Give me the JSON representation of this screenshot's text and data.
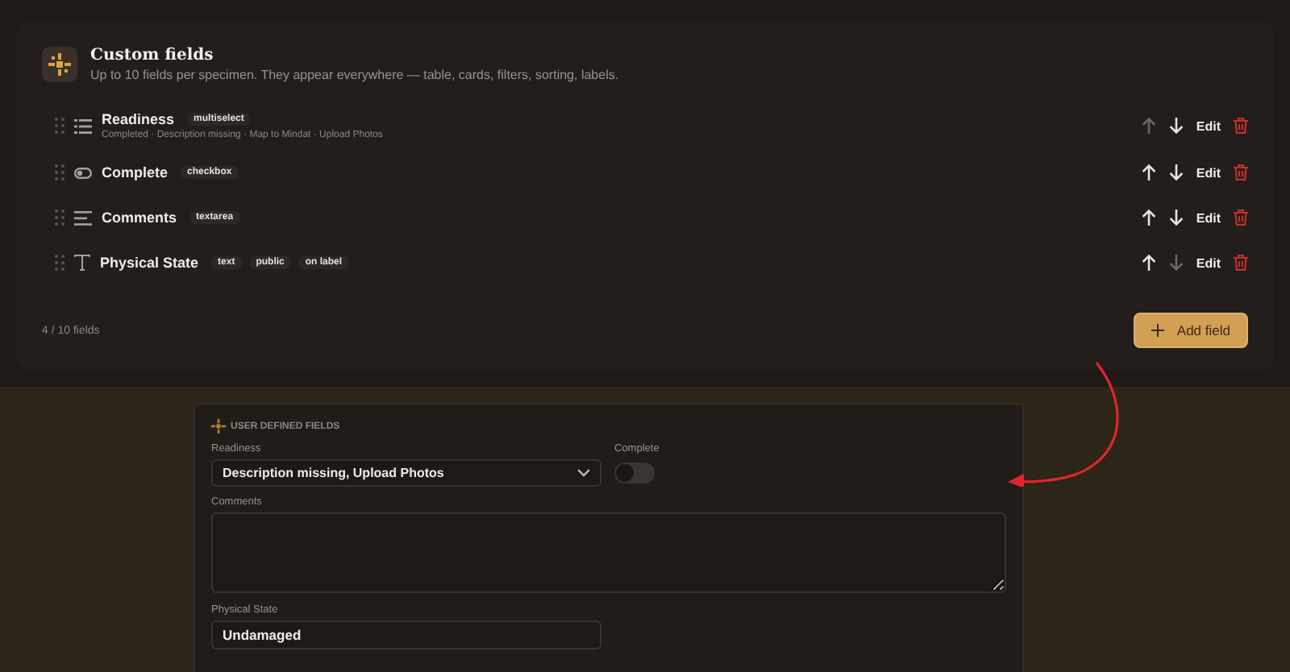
{
  "card": {
    "title": "Custom fields",
    "subtitle": "Up to 10 fields per specimen. They appear everywhere — table, cards, filters, sorting, labels.",
    "fields": [
      {
        "kind": "multiselect",
        "name": "Readiness",
        "tags": [
          "multiselect"
        ],
        "options": "Completed · Description missing · Map to Mindat · Upload Photos",
        "up_disabled": true,
        "down_disabled": false,
        "edit": "Edit"
      },
      {
        "kind": "checkbox",
        "name": "Complete",
        "tags": [
          "checkbox"
        ],
        "up_disabled": false,
        "down_disabled": false,
        "edit": "Edit"
      },
      {
        "kind": "textarea",
        "name": "Comments",
        "tags": [
          "textarea"
        ],
        "up_disabled": false,
        "down_disabled": false,
        "edit": "Edit"
      },
      {
        "kind": "text",
        "name": "Physical State",
        "tags": [
          "text",
          "public",
          "on label"
        ],
        "up_disabled": false,
        "down_disabled": true,
        "edit": "Edit"
      }
    ],
    "count": "4 / 10 fields",
    "add_button": "Add field"
  },
  "preview": {
    "heading": "USER DEFINED FIELDS",
    "readiness_label": "Readiness",
    "readiness_value": "Description missing, Upload Photos",
    "complete_label": "Complete",
    "complete_on": false,
    "comments_label": "Comments",
    "physical_label": "Physical State",
    "physical_value": "Undamaged"
  }
}
